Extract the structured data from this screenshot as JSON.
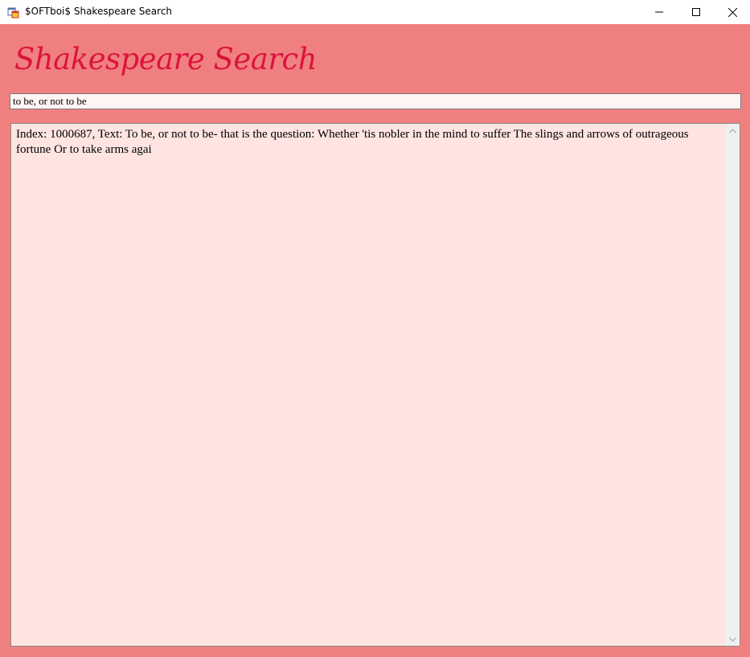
{
  "window": {
    "title": "$OFTboi$ Shakespeare Search"
  },
  "app": {
    "heading": "Shakespeare Search"
  },
  "search": {
    "value": "to be, or not to be"
  },
  "results": {
    "text": "Index: 1000687, Text: To be, or not to be- that is the question: Whether 'tis nobler in the mind to suffer The slings and arrows of outrageous fortune Or to take arms agai"
  },
  "colors": {
    "background": "#f08080",
    "heading": "#dc143c",
    "results_background": "#ffe4e1"
  },
  "icons": {
    "app": "app-icon",
    "minimize": "minimize-icon",
    "maximize": "maximize-icon",
    "close": "close-icon",
    "scroll_up": "chevron-up-icon",
    "scroll_down": "chevron-down-icon"
  }
}
